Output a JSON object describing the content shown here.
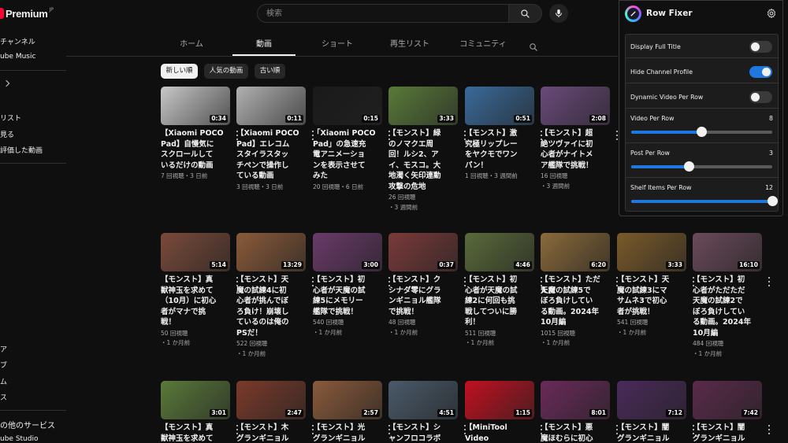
{
  "sidebar": {
    "logo": "Premium",
    "logo_sup": "JP",
    "items": [
      "チャンネル",
      "ube Music",
      "リスト",
      "見る",
      "評価した動画",
      "ア",
      "ブ",
      "ム",
      "ス",
      "の他のサービス",
      "ube Studio"
    ]
  },
  "header": {
    "search_placeholder": "検索"
  },
  "tabs": [
    "ホーム",
    "動画",
    "ショート",
    "再生リスト",
    "コミュニティ"
  ],
  "chips": [
    "新しい順",
    "人気の動画",
    "古い順"
  ],
  "rows": [
    [
      {
        "title": [
          "【Xiaomi POCO",
          "Pad】自慢気に",
          "スクロールして",
          "いるだけの動画"
        ],
        "meta": [
          "7 回視聴・3 日前"
        ],
        "dur": "0:34",
        "bg": "#c8c8c8"
      },
      {
        "title": [
          "【Xiaomi POCO",
          "Pad】エレコム",
          "スタイラスタッ",
          "チペンで操作し",
          "ている動画"
        ],
        "meta": [
          "3 回視聴・3 日前"
        ],
        "dur": "0:11",
        "bg": "#b0b0b0"
      },
      {
        "title": [
          "「Xiaomi POCO",
          "Pad」の急速充",
          "電アニメーショ",
          "ンを表示させて",
          "みた"
        ],
        "meta": [
          "20 回視聴・6 日前"
        ],
        "dur": "0:15",
        "bg": "#1a1a1a"
      },
      {
        "title": [
          "【モンスト】緑",
          "のノマクエ周",
          "回！ルシ2、ア",
          "イ、モスコ。大",
          "地濁く矢印連動",
          "攻撃の危地"
        ],
        "meta": [
          "26 回視聴",
          "・3 週間前"
        ],
        "dur": "3:33",
        "bg": "#5a7a3a"
      },
      {
        "title": [
          "【モンスト】激",
          "究極リップレー",
          "をヤクモでワン",
          "パン！"
        ],
        "meta": [
          "1 回視聴・3 週間前"
        ],
        "dur": "0:51",
        "bg": "#3a6a9a"
      },
      {
        "title": [
          "【モンスト】超",
          "絶ツヴァイに初",
          "心者がナイトメ",
          "ア艦隊で挑戦！"
        ],
        "meta": [
          "16 回視聴",
          "・3 週間前"
        ],
        "dur": "2:08",
        "bg": "#6a4a7a"
      }
    ],
    [
      {
        "title": [
          "【モンスト】真",
          "獣神玉を求めて",
          "（10月）に初心",
          "者がマナで挑",
          "戦！"
        ],
        "meta": [
          "50 回視聴",
          "・1 か月前"
        ],
        "dur": "5:14",
        "bg": "#7a4a3a"
      },
      {
        "title": [
          "【モンスト】天",
          "魔の試練4に初",
          "心者が挑んでぼ",
          "ろ負け！崩壊し",
          "ているのは俺の",
          "PSだ！"
        ],
        "meta": [
          "522 回視聴",
          "・1 か月前"
        ],
        "dur": "13:29",
        "bg": "#8a5a3a"
      },
      {
        "title": [
          "【モンスト】初",
          "心者が天魔の試",
          "練5にメモリー",
          "艦隊で挑戦！"
        ],
        "meta": [
          "540 回視聴",
          "・1 か月前"
        ],
        "dur": "3:00",
        "bg": "#6a3a6a"
      },
      {
        "title": [
          "【モンスト】ク",
          "シナダ零にグラ",
          "ンギニョル艦隊",
          "で挑戦！"
        ],
        "meta": [
          "48 回視聴",
          "・1 か月前"
        ],
        "dur": "0:37",
        "bg": "#7a3a3a"
      },
      {
        "title": [
          "【モンスト】初",
          "心者が天魔の試",
          "練2に何回も挑",
          "戦してついに勝",
          "利！"
        ],
        "meta": [
          "511 回視聴",
          "・1 か月前"
        ],
        "dur": "4:46",
        "bg": "#5a6a3a"
      },
      {
        "title": [
          "【モンスト】ただただ",
          "天魔の試練5で",
          "ぼろ負けしてい",
          "る動画。2024年",
          "10月編"
        ],
        "meta": [
          "1015 回視聴",
          "・1 か月前"
        ],
        "dur": "6:20",
        "bg": "#8a6a3a"
      },
      {
        "title": [
          "【モンスト】天",
          "魔の試練3にマ",
          "サムネ3で初心",
          "者が挑戦！"
        ],
        "meta": [
          "541 回視聴",
          "・1 か月前"
        ],
        "dur": "3:33",
        "bg": "#7a5a2a"
      },
      {
        "title": [
          "【モンスト】初",
          "心者がただただ",
          "天魔の試練2で",
          "ぼろ負けしてい",
          "る動画。2024年",
          "10月編"
        ],
        "meta": [
          "484 回視聴",
          "・1 か月前"
        ],
        "dur": "16:10",
        "bg": "#6a4a5a"
      }
    ],
    [
      {
        "title": [
          "【モンスト】真",
          "獣神玉を求めて"
        ],
        "meta": [],
        "dur": "3:01",
        "bg": "#5a7a3a"
      },
      {
        "title": [
          "【モンスト】木",
          "グランギニョル"
        ],
        "meta": [],
        "dur": "2:47",
        "bg": "#7a3a2a"
      },
      {
        "title": [
          "【モンスト】光",
          "グランギニョル"
        ],
        "meta": [],
        "dur": "2:57",
        "bg": "#8a5a3a"
      },
      {
        "title": [
          "【モンスト】シ",
          "ャンフロコラボ"
        ],
        "meta": [],
        "dur": "4:51",
        "bg": "#4a5a6a"
      },
      {
        "title": [
          "【MiniTool",
          "Video"
        ],
        "meta": [],
        "dur": "1:15",
        "bg": "#c01020"
      },
      {
        "title": [
          "【モンスト】悪",
          "魔ほむらに初心"
        ],
        "meta": [],
        "dur": "8:01",
        "bg": "#6a2a5a"
      },
      {
        "title": [
          "【モンスト】闇",
          "グランギニョル"
        ],
        "meta": [],
        "dur": "7:12",
        "bg": "#4a2a5a"
      },
      {
        "title": [
          "【モンスト】闇",
          "グランギニョル"
        ],
        "meta": [],
        "dur": "7:42",
        "bg": "#5a2a4a"
      }
    ]
  ],
  "panel": {
    "title": "Row Fixer",
    "toggles": [
      {
        "label": "Display Full Title",
        "on": false
      },
      {
        "label": "Hide Channel Profile",
        "on": true
      },
      {
        "label": "Dynamic Video Per Row",
        "on": false
      }
    ],
    "sliders": [
      {
        "label": "Video Per Row",
        "value": "8",
        "fraction": 0.5
      },
      {
        "label": "Post Per Row",
        "value": "3",
        "fraction": 0.41
      },
      {
        "label": "Shelf Items Per Row",
        "value": "12",
        "fraction": 1.0
      }
    ]
  },
  "colors": {
    "accent": "#1e78e0",
    "logo_red": "#ff0033"
  },
  "icons": [
    "search-icon",
    "mic-icon",
    "gear-icon",
    "kebab-icon",
    "chevron-right-icon"
  ]
}
